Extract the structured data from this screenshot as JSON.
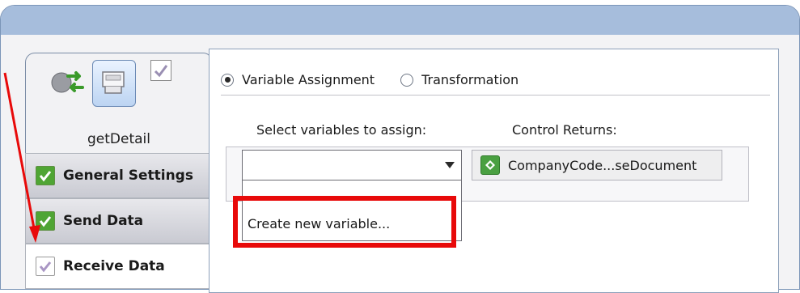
{
  "step": {
    "name": "getDetail"
  },
  "nav": {
    "items": [
      {
        "label": "General Settings",
        "status": "complete"
      },
      {
        "label": "Send Data",
        "status": "complete"
      },
      {
        "label": "Receive Data",
        "status": "pending",
        "selected": true
      }
    ]
  },
  "mode": {
    "options": [
      {
        "label": "Variable Assignment",
        "selected": true
      },
      {
        "label": "Transformation",
        "selected": false
      }
    ]
  },
  "assign": {
    "select_label": "Select variables to assign:",
    "control_label": "Control Returns:",
    "selected_value": "",
    "dropdown_options": [
      "Create new variable..."
    ],
    "control_return": "CompanyCode...seDocument"
  },
  "colors": {
    "header_band": "#a6bddc",
    "highlight": "#e80a0a",
    "check_green": "#4fa534"
  },
  "icons": {
    "step_icon_left": "send-receive-arrows-icon",
    "step_icon_right": "device-connector-icon",
    "check": "checkmark-icon",
    "dropdown_arrow": "triangle-down-icon",
    "return_type": "green-diamond-icon"
  }
}
